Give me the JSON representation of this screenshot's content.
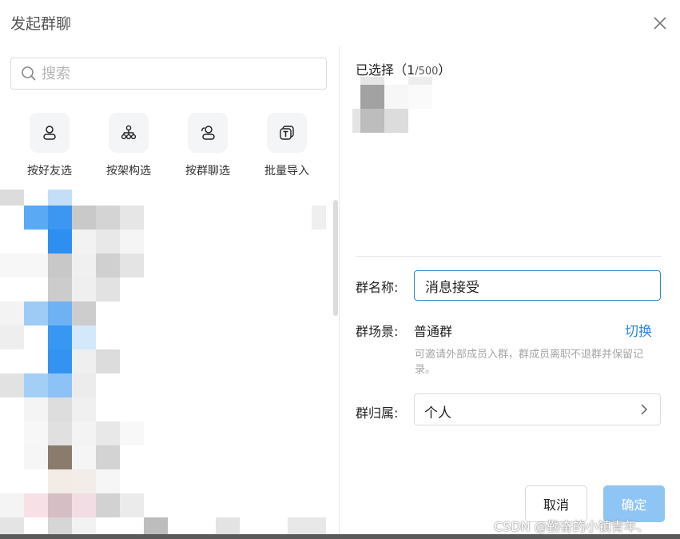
{
  "dialog": {
    "title": "发起群聊",
    "close_icon": "close-icon"
  },
  "search": {
    "placeholder": "搜索",
    "icon": "search-icon"
  },
  "tools": [
    {
      "label": "按好友选",
      "icon": "person-icon"
    },
    {
      "label": "按架构选",
      "icon": "org-chart-icon"
    },
    {
      "label": "按群聊选",
      "icon": "group-icon"
    },
    {
      "label": "批量导入",
      "icon": "import-icon"
    }
  ],
  "selected": {
    "label": "已选择",
    "open_paren": "（",
    "count": "1",
    "max": "/500",
    "close_paren": "）"
  },
  "form": {
    "name_label": "群名称:",
    "name_value": "消息接受",
    "scene_label": "群场景:",
    "scene_value": "普通群",
    "switch_label": "切换",
    "scene_desc": "可邀请外部成员入群，群成员离职不退群并保留记录。",
    "owner_label": "群归属:",
    "owner_value": "个人"
  },
  "actions": {
    "cancel": "取消",
    "confirm": "确定"
  },
  "watermark": "CSDN @勤奋的小镇青年、",
  "colors": {
    "accent": "#2b88d9",
    "confirm_disabled": "#8fc5f4"
  }
}
